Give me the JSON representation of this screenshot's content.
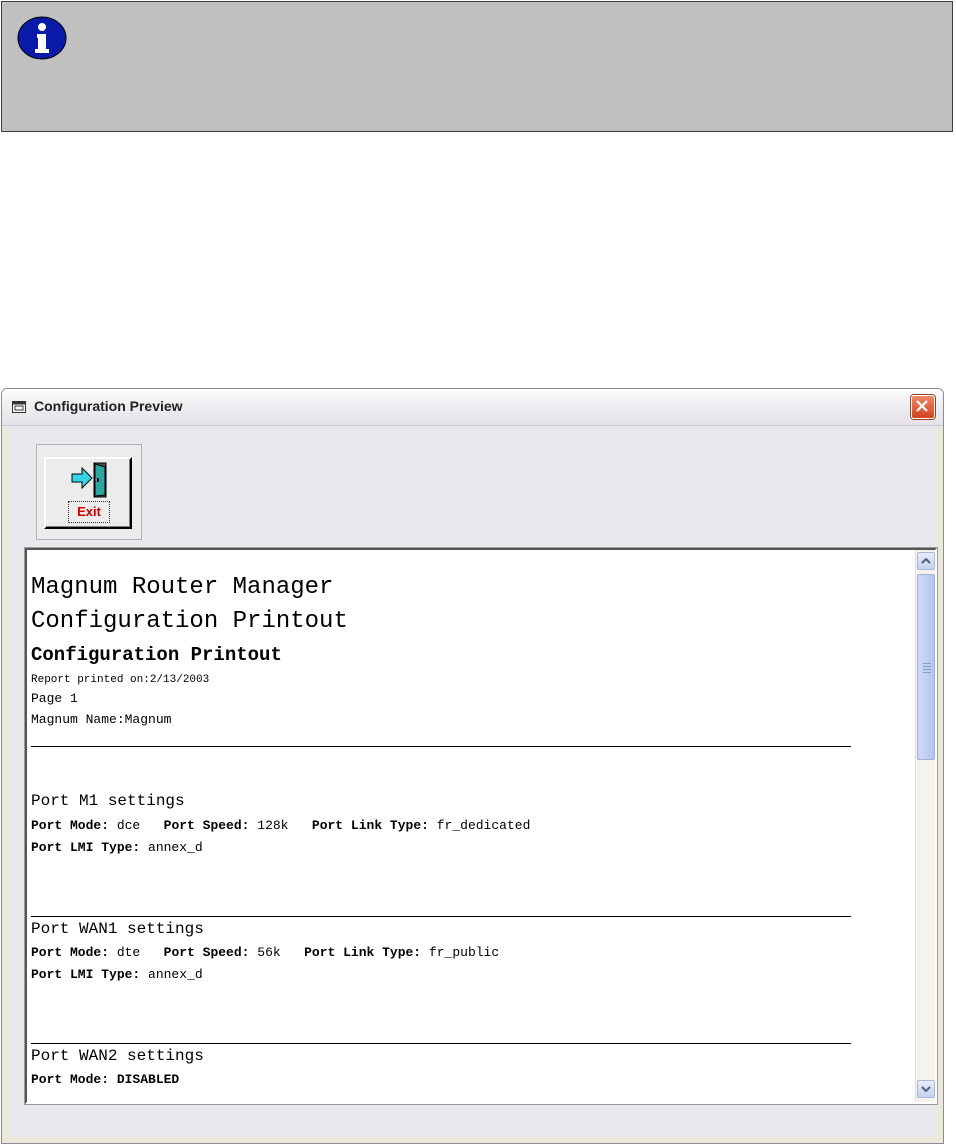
{
  "window": {
    "title": "Configuration Preview"
  },
  "toolbar": {
    "exit_label": "Exit"
  },
  "report": {
    "app_title": "Magnum Router Manager",
    "doc_title": "Configuration Printout",
    "sub_title": "Configuration Printout",
    "printed_on": "Report printed on:2/13/2003",
    "page": "Page 1",
    "name": "Magnum Name:Magnum",
    "ports": [
      {
        "heading": "Port M1 settings",
        "row1": [
          {
            "label": "Port Mode:",
            "value": "dce"
          },
          {
            "label": "Port Speed:",
            "value": "128k"
          },
          {
            "label": "Port Link Type:",
            "value": "fr_dedicated"
          }
        ],
        "row2": [
          {
            "label": "Port LMI Type:",
            "value": "annex_d"
          }
        ]
      },
      {
        "heading": "Port WAN1 settings",
        "row1": [
          {
            "label": "Port Mode:",
            "value": "dte"
          },
          {
            "label": "Port Speed:",
            "value": "56k"
          },
          {
            "label": "Port Link Type:",
            "value": "fr_public"
          }
        ],
        "row2": [
          {
            "label": "Port LMI Type:",
            "value": "annex_d"
          }
        ]
      },
      {
        "heading": "Port WAN2 settings",
        "row1": [
          {
            "label": "Port Mode:",
            "value": "DISABLED"
          }
        ]
      }
    ]
  },
  "colors": {
    "banner_bg": "#c0c0c0",
    "info_icon": "#0a1aa8",
    "close_button": "#d4411d",
    "exit_text": "#d40000"
  }
}
